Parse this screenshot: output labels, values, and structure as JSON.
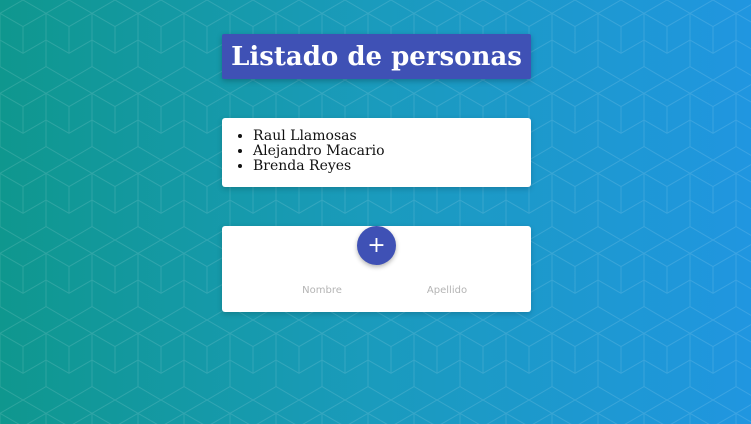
{
  "page": {
    "title": "Listado de personas"
  },
  "people": [
    "Raul Llamosas",
    "Alejandro Macario",
    "Brenda Reyes"
  ],
  "form": {
    "add_label": "+",
    "nombre_placeholder": "Nombre",
    "nombre_value": "",
    "apellido_placeholder": "Apellido",
    "apellido_value": ""
  },
  "colors": {
    "accent": "#3f51b5",
    "background_start": "#0f978e",
    "background_end": "#2096e0",
    "card": "#ffffff"
  }
}
